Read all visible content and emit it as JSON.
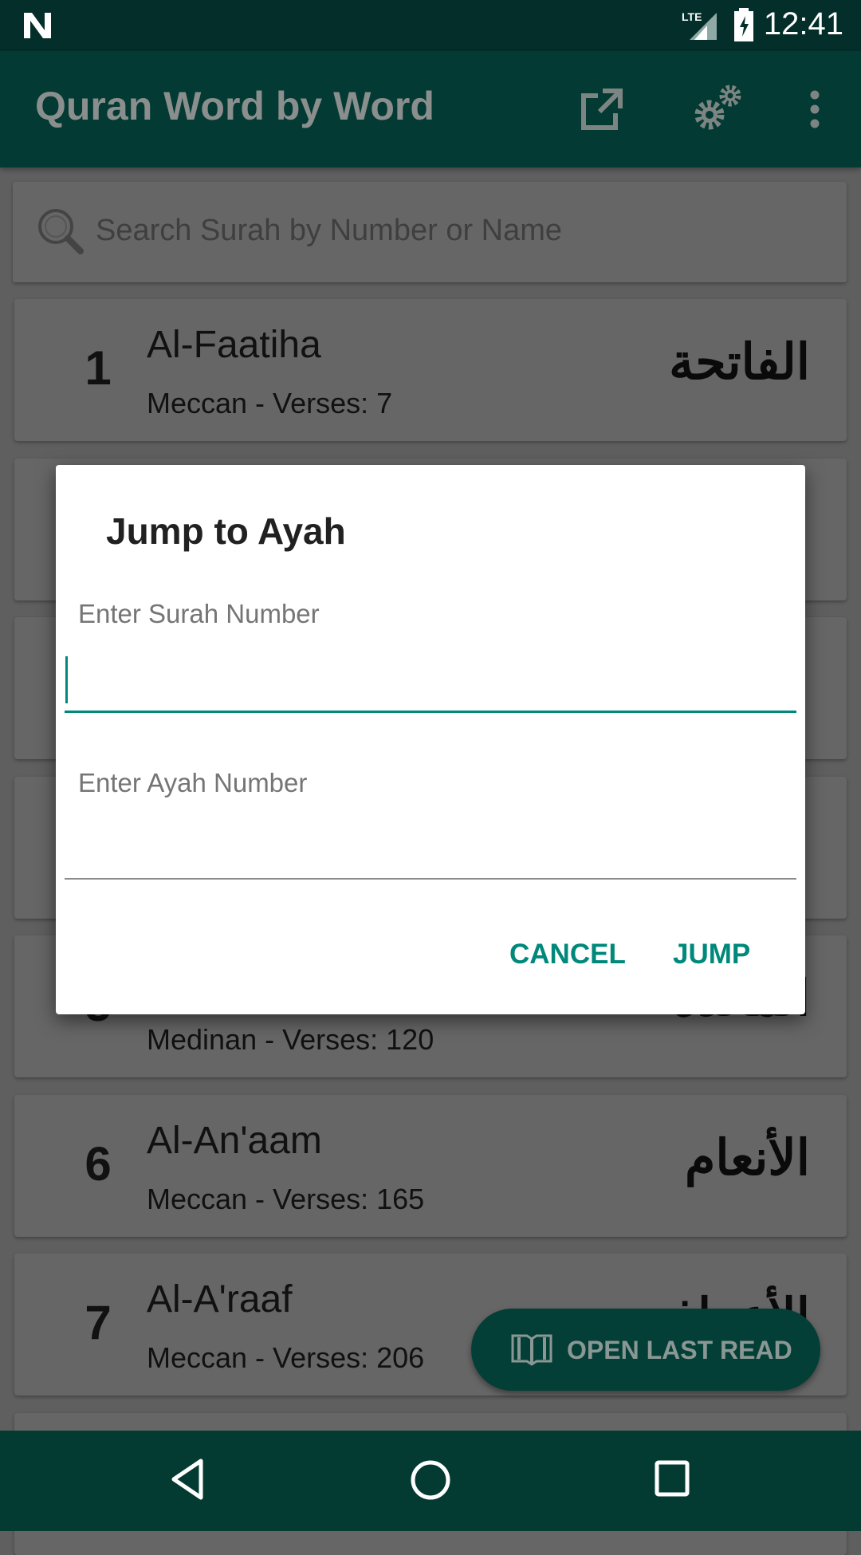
{
  "status_bar": {
    "time": "12:41",
    "network": "LTE",
    "icons": [
      "notification-n-icon",
      "lte-signal-icon",
      "battery-charging-icon"
    ]
  },
  "toolbar": {
    "title": "Quran Word by Word",
    "icons": [
      "share-icon",
      "settings-gears-icon",
      "more-vert-icon"
    ]
  },
  "search": {
    "placeholder": "Search Surah by Number or Name",
    "icon": "search-icon"
  },
  "surahs": [
    {
      "number": "1",
      "name": "Al-Faatiha",
      "info": "Meccan - Verses: 7",
      "arabic": "الفاتحة"
    },
    {
      "number": "",
      "name": "",
      "info": "",
      "arabic": ""
    },
    {
      "number": "",
      "name": "",
      "info": "",
      "arabic": ""
    },
    {
      "number": "",
      "name": "",
      "info": "",
      "arabic": ""
    },
    {
      "number": "5",
      "name": "",
      "info": "Medinan - Verses: 120",
      "arabic": "المائدة"
    },
    {
      "number": "6",
      "name": "Al-An'aam",
      "info": "Meccan - Verses: 165",
      "arabic": "الأنعام"
    },
    {
      "number": "7",
      "name": "Al-A'raaf",
      "info": "Meccan - Verses: 206",
      "arabic": "الأعراف"
    },
    {
      "number": "",
      "name": "",
      "info": "",
      "arabic": ""
    }
  ],
  "fab": {
    "label": "OPEN LAST READ",
    "icon": "book-open-icon"
  },
  "dialog": {
    "title": "Jump to Ayah",
    "surah_label": "Enter Surah Number",
    "surah_value": "",
    "ayah_label": "Enter Ayah Number",
    "ayah_value": "",
    "cancel": "CANCEL",
    "jump": "JUMP"
  },
  "colors": {
    "accent": "#00897b",
    "primary_dark": "#00695c",
    "nav_bar": "#033b33"
  }
}
